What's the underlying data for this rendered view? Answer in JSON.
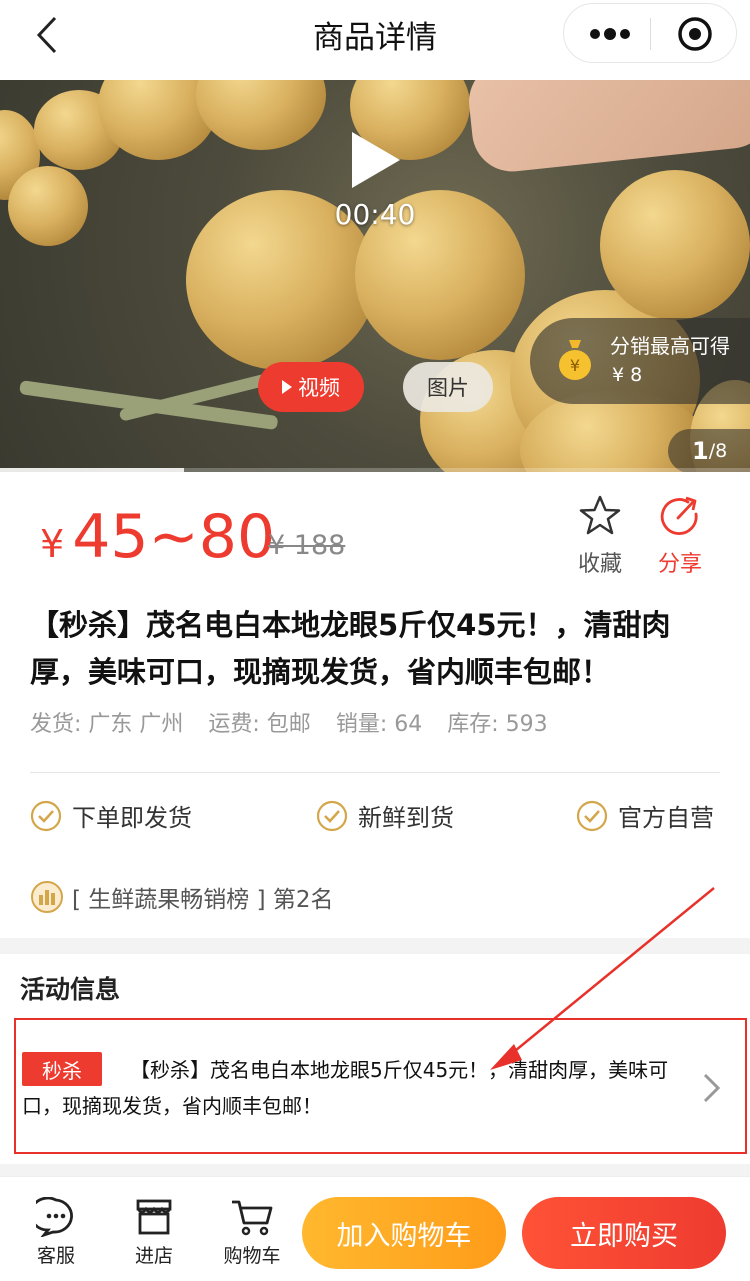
{
  "navbar": {
    "title": "商品详情",
    "back_icon": "chevron-left-icon",
    "more_icon": "more-dots-icon",
    "target_icon": "target-circle-icon"
  },
  "media": {
    "time": "00:40",
    "distribution_label": "分销最高可得",
    "distribution_value": "¥ 8",
    "pager_current": "1",
    "pager_total": "/8",
    "video_label": "视频",
    "photo_label": "图片",
    "progress": 0.245
  },
  "product": {
    "price_symbol": "¥",
    "price": "45~80",
    "original_price": "¥ 188",
    "favorite_label": "收藏",
    "share_label": "分享",
    "title": "【秒杀】茂名电白本地龙眼5斤仅45元！，清甜肉厚，美味可口，现摘现发货，省内顺丰包邮！",
    "ship_from": "发货: 广东 广州",
    "shipping_fee": "运费: 包邮",
    "sales": "销量: 64",
    "stock": "库存: 593",
    "features": [
      "下单即发货",
      "新鲜到货",
      "官方自营"
    ],
    "rank_text": "[ 生鲜蔬果畅销榜 ] 第2名"
  },
  "activity": {
    "section_title": "活动信息",
    "tag": "秒杀",
    "text": "【秒杀】茂名电白本地龙眼5斤仅45元！，清甜肉厚，美味可口，现摘现发货，省内顺丰包邮！"
  },
  "bottom_bar": {
    "service_label": "客服",
    "store_label": "进店",
    "cart_label": "购物车",
    "add_cart_label": "加入购物车",
    "buy_now_label": "立即购买"
  },
  "colors": {
    "accent_red": "#ee3b30",
    "accent_orange": "#ffb82e",
    "check_gold": "#d4a64a"
  }
}
